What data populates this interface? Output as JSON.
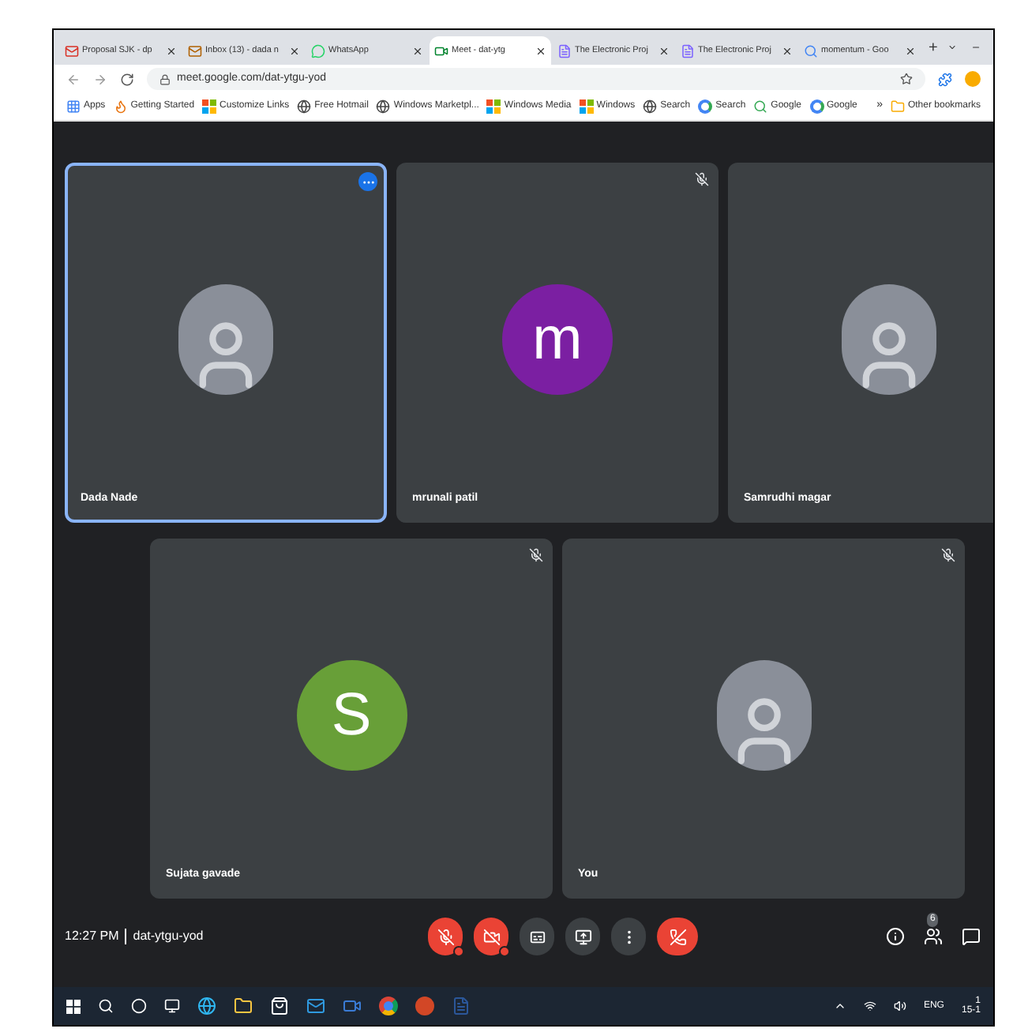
{
  "tabs": [
    {
      "title": "Proposal SJK - dp",
      "kind": "mail",
      "selected": false
    },
    {
      "title": "Inbox (13) - dada n",
      "kind": "inbox",
      "selected": false
    },
    {
      "title": "WhatsApp",
      "kind": "chat",
      "selected": false
    },
    {
      "title": "Meet - dat-ytg",
      "kind": "meet",
      "selected": true
    },
    {
      "title": "The Electronic Proj",
      "kind": "doc",
      "selected": false
    },
    {
      "title": "The Electronic Proj",
      "kind": "doc",
      "selected": false
    },
    {
      "title": "momentum - Goo",
      "kind": "search",
      "selected": false
    }
  ],
  "new_tab": "+",
  "address": "meet.google.com/dat-ytgu-yod",
  "bookmarks": [
    {
      "label": "Apps",
      "kind": "grid"
    },
    {
      "label": "Getting Started",
      "kind": "flame"
    },
    {
      "label": "Customize Links",
      "kind": "windows"
    },
    {
      "label": "Free Hotmail",
      "kind": "globe"
    },
    {
      "label": "Windows Marketpl...",
      "kind": "globe"
    },
    {
      "label": "Windows Media",
      "kind": "windows"
    },
    {
      "label": "Windows",
      "kind": "windows"
    },
    {
      "label": "Search",
      "kind": "globe"
    },
    {
      "label": "Search",
      "kind": "g"
    },
    {
      "label": "Google",
      "kind": "magnifier"
    },
    {
      "label": "Google",
      "kind": "g"
    }
  ],
  "bookmarks_more": "»",
  "other_bookmarks": "Other bookmarks",
  "participants_row1": [
    {
      "name": "Dada Nade",
      "kind": "photo",
      "highlighted": true,
      "muted": false
    },
    {
      "name": "mrunali patil",
      "kind": "letter",
      "letter": "m",
      "color": "#7b1fa2",
      "highlighted": false,
      "muted": true
    },
    {
      "name": "Samrudhi magar",
      "kind": "photo",
      "highlighted": false,
      "muted": false
    }
  ],
  "participants_row2": [
    {
      "name": "Sujata gavade",
      "kind": "letter",
      "letter": "S",
      "color": "#689f38",
      "highlighted": false,
      "muted": true
    },
    {
      "name": "You",
      "kind": "photo",
      "highlighted": false,
      "muted": true
    }
  ],
  "meeting": {
    "time": "12:27 PM",
    "code": "dat-ytgu-yod",
    "participant_count": "6"
  },
  "controls": [
    {
      "kind": "mic",
      "alert": true
    },
    {
      "kind": "camera",
      "alert": true
    },
    {
      "kind": "captions",
      "alert": false
    },
    {
      "kind": "present",
      "alert": false
    },
    {
      "kind": "more",
      "alert": false
    },
    {
      "kind": "hangup",
      "alert": false
    }
  ],
  "taskbar": {
    "language": "ENG",
    "clock_time": "1",
    "clock_date": "15-1"
  }
}
